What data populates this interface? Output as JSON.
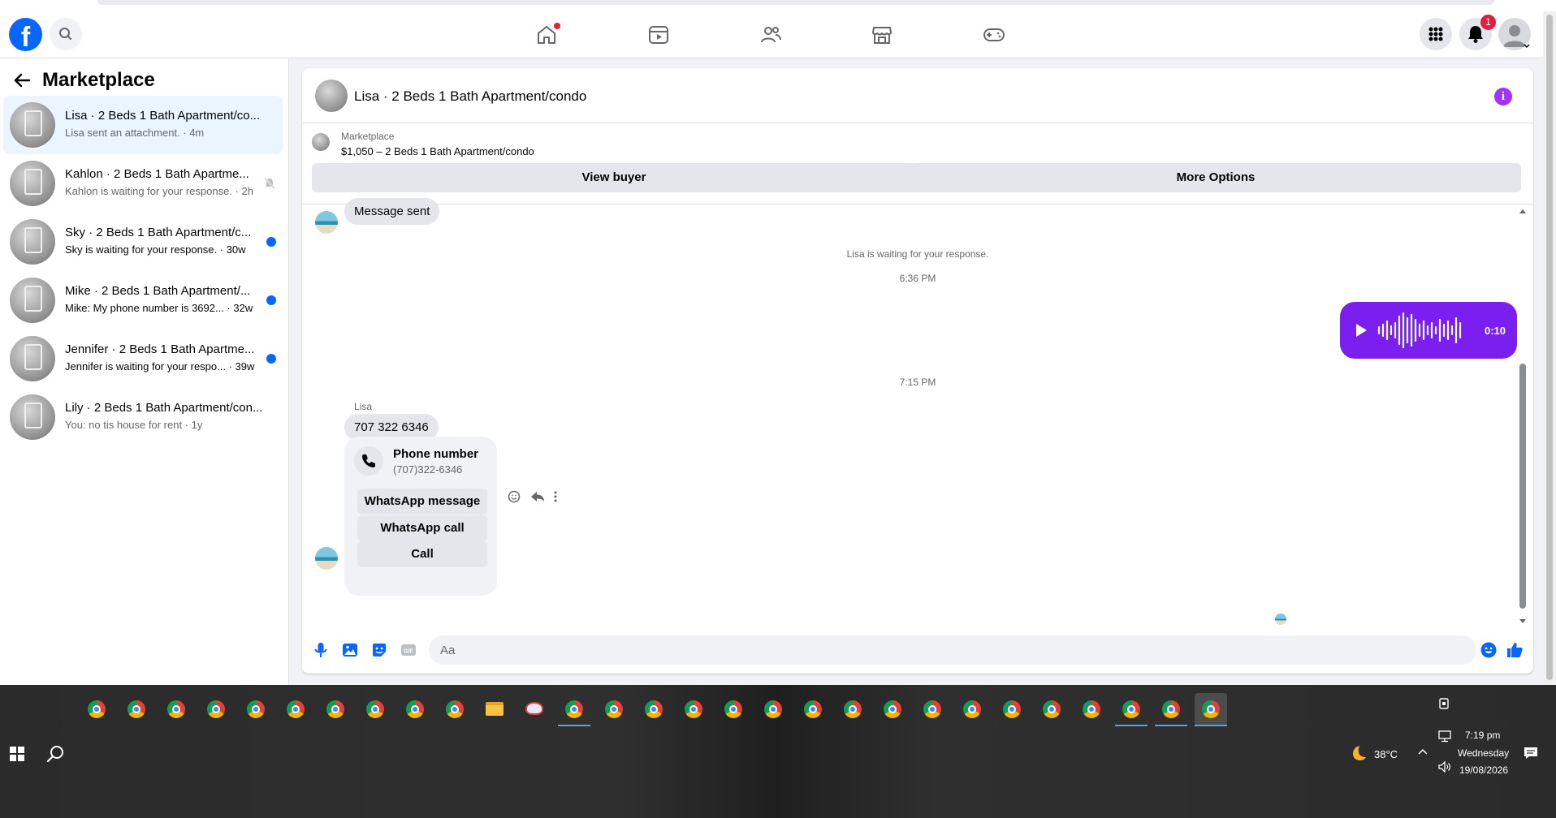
{
  "sidebar": {
    "title": "Marketplace",
    "conversations": [
      {
        "title": "Lisa · 2 Beds 1 Bath Apartment/co...",
        "subtitle": "Lisa sent an attachment. · 4m",
        "active": true,
        "unread": false,
        "muted": false
      },
      {
        "title": "Kahlon · 2 Beds 1 Bath Apartme...",
        "subtitle": "Kahlon is waiting for your response. · 2h",
        "active": false,
        "unread": false,
        "muted": true
      },
      {
        "title": "Sky · 2 Beds 1 Bath Apartment/c...",
        "subtitle": "Sky is waiting for your response. · 30w",
        "active": false,
        "unread": true,
        "muted": false
      },
      {
        "title": "Mike · 2 Beds 1 Bath Apartment/...",
        "subtitle": "Mike: My phone number is 3692... · 32w",
        "active": false,
        "unread": true,
        "muted": false
      },
      {
        "title": "Jennifer · 2 Beds 1 Bath Apartme...",
        "subtitle": "Jennifer is waiting for your respo... · 39w",
        "active": false,
        "unread": true,
        "muted": false
      },
      {
        "title": "Lily · 2 Beds 1 Bath Apartment/con...",
        "subtitle": "You: no tis house for rent · 1y",
        "active": false,
        "unread": false,
        "muted": false
      }
    ]
  },
  "topnav": {
    "notification_count": "1"
  },
  "chat": {
    "title": "Lisa · 2 Beds 1 Bath Apartment/condo",
    "listing_label": "Marketplace",
    "listing_price": "$1,050 – 2 Beds 1 Bath Apartment/condo",
    "view_buyer": "View buyer",
    "more_options": "More Options",
    "message_sent": "Message sent",
    "waiting_text": "Lisa is waiting for your response.",
    "time_1": "6:36 PM",
    "voice_duration": "0:10",
    "time_2": "7:15 PM",
    "sender_name": "Lisa",
    "phone_message": "707 322 6346",
    "card_title": "Phone number",
    "card_number": "(707)322-6346",
    "btn_whatsapp_message": "WhatsApp message",
    "btn_whatsapp_call": "WhatsApp call",
    "btn_call": "Call",
    "composer_placeholder": "Aa",
    "gif_label": "GIF"
  },
  "taskbar": {
    "temperature": "38°C",
    "time": "7:19 pm",
    "day": "Wednesday",
    "date": "19/08/2026"
  },
  "colors": {
    "brand": "#0866ff",
    "voice_bubble": "#7b1ff0",
    "unread_dot": "#0866ff"
  }
}
